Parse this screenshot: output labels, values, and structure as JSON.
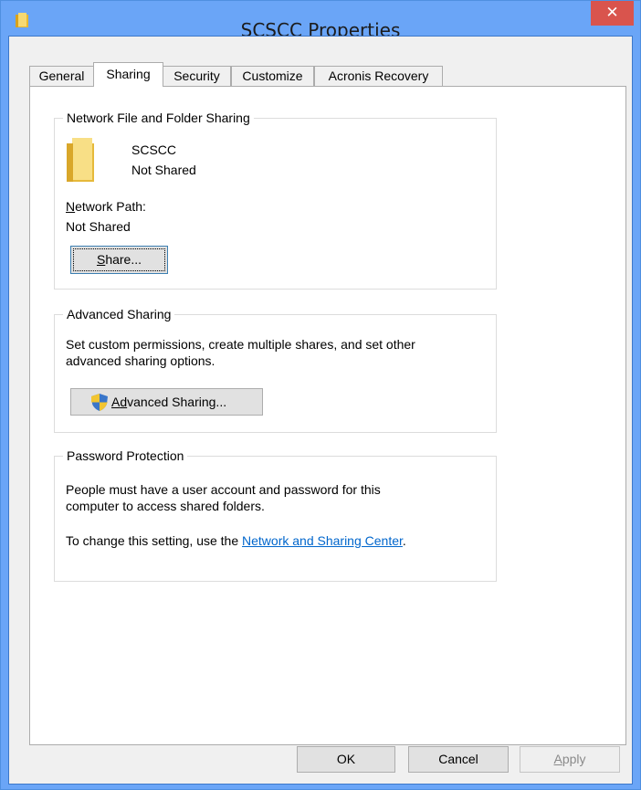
{
  "window": {
    "title": "SCSCC Properties",
    "close_glyph": "✕"
  },
  "tabs": [
    {
      "label": "General"
    },
    {
      "label": "Sharing"
    },
    {
      "label": "Security"
    },
    {
      "label": "Customize"
    },
    {
      "label": "Acronis Recovery"
    }
  ],
  "network_sharing": {
    "legend": "Network File and Folder Sharing",
    "folder_name": "SCSCC",
    "folder_status": "Not Shared",
    "path_label_prefix": "N",
    "path_label_rest": "etwork Path:",
    "path_value": "Not Shared",
    "share_button_prefix": "S",
    "share_button_rest": "hare..."
  },
  "advanced_sharing": {
    "legend": "Advanced Sharing",
    "description_line1": "Set custom permissions, create multiple shares, and set other",
    "description_line2": "advanced sharing options.",
    "button_prefix": "A",
    "button_accel": "d",
    "button_rest": "vanced Sharing..."
  },
  "password_protection": {
    "legend": "Password Protection",
    "description_line1": "People must have a user account and password for this",
    "description_line2": "computer to access shared folders.",
    "setting_text": "To change this setting, use the ",
    "link_text": "Network and Sharing Center",
    "setting_suffix": "."
  },
  "footer": {
    "ok_label": "OK",
    "cancel_label": "Cancel",
    "apply_prefix": "A",
    "apply_rest": "pply"
  },
  "colors": {
    "titlebar": "#6aa5f7",
    "close_button": "#d9544d",
    "link": "#0066cc",
    "folder": "#f2c94c"
  },
  "icons": {
    "title": "folder-icon",
    "folder": "folder-icon",
    "shield": "uac-shield-icon"
  }
}
